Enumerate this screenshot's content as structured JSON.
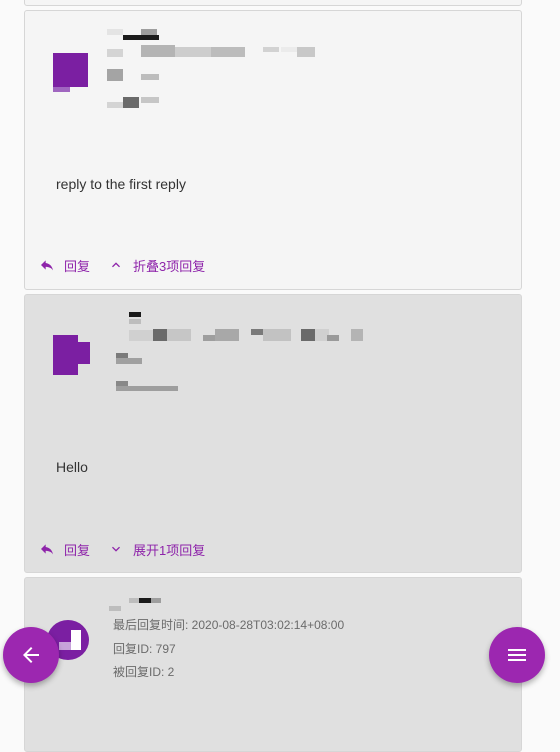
{
  "theme": {
    "accent": "#9c27b0",
    "action_color": "#8e24aa"
  },
  "cards": [
    {
      "body": "reply to the first reply",
      "actions": {
        "reply_label": "回复",
        "toggle_label": "折叠3项回复",
        "toggle_icon": "chevron-up-icon"
      }
    },
    {
      "body": "Hello",
      "actions": {
        "reply_label": "回复",
        "toggle_label": "展开1项回复",
        "toggle_icon": "chevron-down-icon"
      }
    },
    {
      "meta": {
        "last_reply_time": "最后回复时间: 2020-08-28T03:02:14+08:00",
        "reply_id": "回复ID: 797",
        "replied_id": "被回复ID: 2"
      }
    }
  ],
  "fabs": {
    "back_icon": "arrow-left-icon",
    "menu_icon": "menu-icon"
  }
}
